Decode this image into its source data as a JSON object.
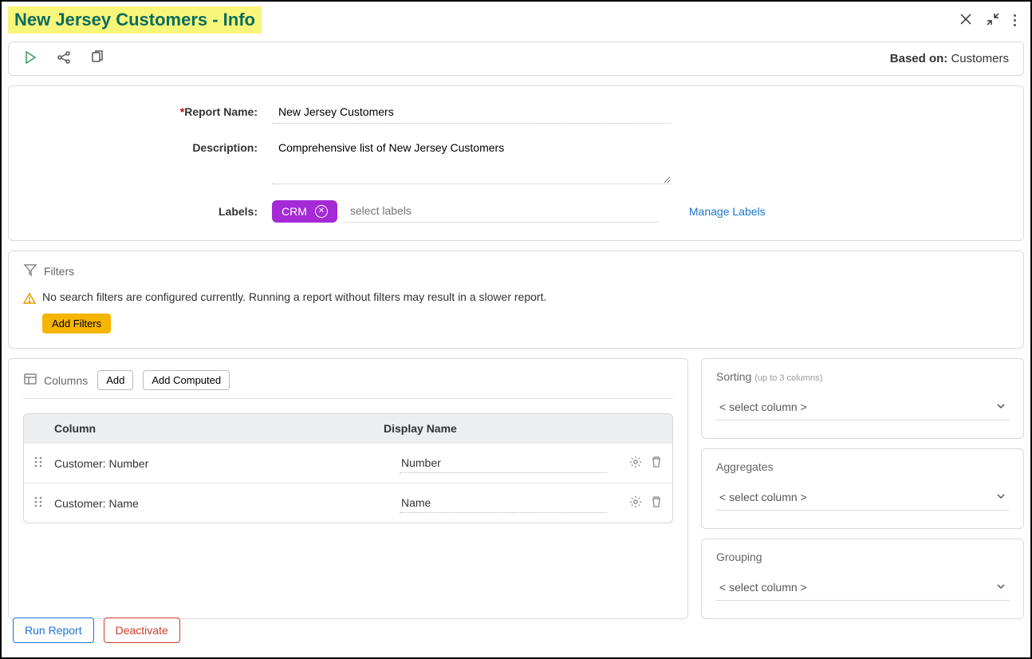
{
  "header": {
    "title": "New Jersey Customers - Info"
  },
  "toolbar": {
    "based_on_label": "Based on:",
    "based_on_value": "Customers"
  },
  "form": {
    "report_name_label": "Report Name:",
    "report_name_value": "New Jersey Customers",
    "description_label": "Description:",
    "description_value": "Comprehensive list of New Jersey Customers",
    "labels_label": "Labels:",
    "label_chip": "CRM",
    "labels_placeholder": "select labels",
    "manage_labels": "Manage Labels"
  },
  "filters": {
    "title": "Filters",
    "warn_text": "No search filters are configured currently. Running a report without filters may result in a slower report.",
    "add_button": "Add Filters"
  },
  "columns": {
    "title": "Columns",
    "add_button": "Add",
    "add_computed_button": "Add Computed",
    "header_col": "Column",
    "header_display": "Display Name",
    "rows": [
      {
        "column": "Customer: Number",
        "display": "Number"
      },
      {
        "column": "Customer: Name",
        "display": "Name"
      }
    ]
  },
  "sorting": {
    "title": "Sorting",
    "subtitle": "(up to 3 columns)",
    "placeholder": "< select column >"
  },
  "aggregates": {
    "title": "Aggregates",
    "placeholder": "< select column >"
  },
  "grouping": {
    "title": "Grouping",
    "placeholder": "< select column >"
  },
  "footer": {
    "run": "Run Report",
    "deactivate": "Deactivate"
  }
}
